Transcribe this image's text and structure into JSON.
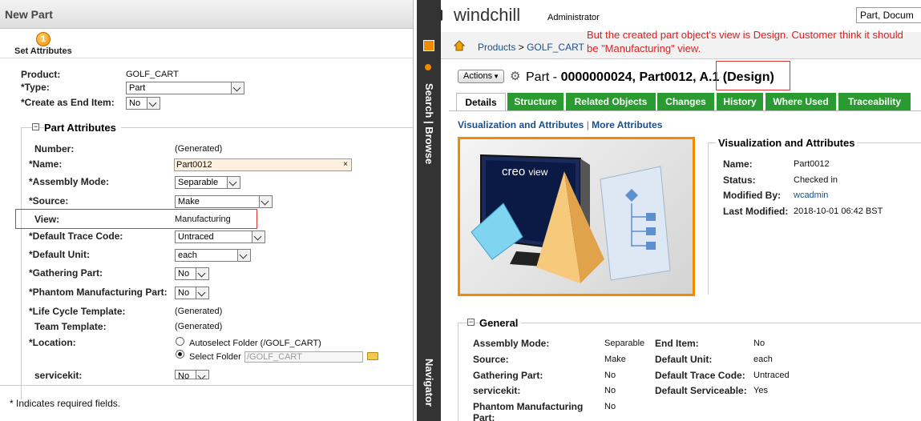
{
  "left": {
    "title": "New Part",
    "step": {
      "number": "1",
      "label": "Set Attributes"
    },
    "product": {
      "label": "Product:",
      "value": "GOLF_CART"
    },
    "type": {
      "label": "Type:",
      "value": "Part"
    },
    "end_item": {
      "label": "Create as End Item:",
      "value": "No"
    },
    "section_title": "Part Attributes",
    "fields": {
      "number": {
        "label": "Number:",
        "value": "(Generated)"
      },
      "name": {
        "label": "Name:",
        "value": "Part0012"
      },
      "assembly_mode": {
        "label": "Assembly Mode:",
        "value": "Separable"
      },
      "source": {
        "label": "Source:",
        "value": "Make"
      },
      "view": {
        "label": "View:",
        "value": "Manufacturing"
      },
      "trace_code": {
        "label": "Default Trace Code:",
        "value": "Untraced"
      },
      "unit": {
        "label": "Default Unit:",
        "value": "each"
      },
      "gathering": {
        "label": "Gathering Part:",
        "value": "No"
      },
      "phantom": {
        "label": "Phantom Manufacturing Part:",
        "value": "No"
      },
      "lifecycle": {
        "label": "Life Cycle Template:",
        "value": "(Generated)"
      },
      "team": {
        "label": "Team Template:",
        "value": "(Generated)"
      },
      "location": {
        "label": "Location:",
        "autoselect": "Autoselect Folder (/GOLF_CART)",
        "select": "Select Folder",
        "folder_value": "/GOLF_CART"
      },
      "servicekit": {
        "label": "servicekit:",
        "value": "No"
      }
    },
    "required_asterisk": "*",
    "footer_note": "* Indicates required fields."
  },
  "sidebar": {
    "search_browse": "Search | Browse",
    "navigator": "Navigator"
  },
  "header": {
    "brand": "windchill",
    "user": "Administrator",
    "search_value": "Part, Docum",
    "breadcrumb": {
      "products": "Products",
      "separator": ">",
      "context": "GOLF_CART"
    },
    "annotation": "But the created part object's view is Design. Customer think it should be \"Manufacturing\" view."
  },
  "object": {
    "actions_label": "Actions",
    "title_prefix": "Part - ",
    "title_bold": "0000000024, Part0012, A.1 (Design)"
  },
  "tabs": [
    "Details",
    "Structure",
    "Related Objects",
    "Changes",
    "History",
    "Where Used",
    "Traceability"
  ],
  "sublinks": {
    "visualization": "Visualization and Attributes",
    "separator": "|",
    "more": "More Attributes"
  },
  "viz": {
    "logo_text": "creo",
    "logo_suffix": "view",
    "title": "Visualization and Attributes",
    "rows": [
      {
        "label": "Name:",
        "value": "Part0012"
      },
      {
        "label": "Status:",
        "value": "Checked in"
      },
      {
        "label": "Modified By:",
        "value": "wcadmin"
      },
      {
        "label": "Last Modified:",
        "value": "2018-10-01 06:42 BST"
      }
    ]
  },
  "general": {
    "title": "General",
    "rows": [
      {
        "label": "Assembly Mode:",
        "value": "Separable",
        "label2": "End Item:",
        "value2": "No"
      },
      {
        "label": "Source:",
        "value": "Make",
        "label2": "Default Unit:",
        "value2": "each"
      },
      {
        "label": "Gathering Part:",
        "value": "No",
        "label2": "Default Trace Code:",
        "value2": "Untraced"
      },
      {
        "label": "servicekit:",
        "value": "No",
        "label2": "Default Serviceable:",
        "value2": "Yes"
      },
      {
        "label": "Phantom Manufacturing Part:",
        "value": "No",
        "label2": "",
        "value2": ""
      }
    ]
  },
  "colors": {
    "tab_green": "#2a9b30",
    "accent_orange": "#f08a00",
    "annotation_red": "#e02020",
    "link_blue": "#1b4f8a"
  }
}
